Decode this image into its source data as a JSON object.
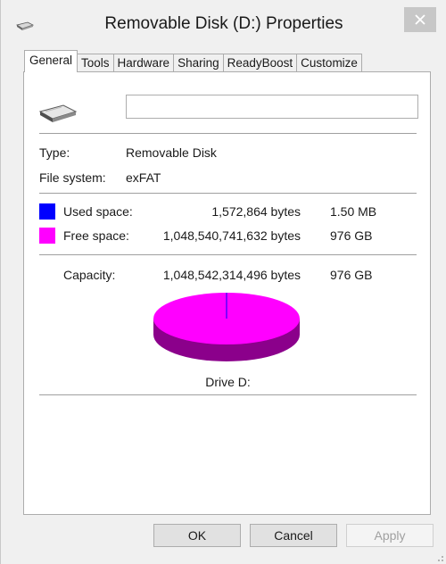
{
  "window": {
    "title": "Removable Disk (D:) Properties"
  },
  "tabs": [
    "General",
    "Tools",
    "Hardware",
    "Sharing",
    "ReadyBoost",
    "Customize"
  ],
  "general": {
    "name_value": "",
    "type_label": "Type:",
    "type_value": "Removable Disk",
    "fs_label": "File system:",
    "fs_value": "exFAT",
    "used": {
      "label": "Used space:",
      "bytes": "1,572,864 bytes",
      "size": "1.50 MB",
      "color": "#0000ff"
    },
    "free": {
      "label": "Free space:",
      "bytes": "1,048,540,741,632 bytes",
      "size": "976 GB",
      "color": "#ff00ff"
    },
    "capacity": {
      "label": "Capacity:",
      "bytes": "1,048,542,314,496 bytes",
      "size": "976 GB"
    },
    "drive_label": "Drive D:",
    "pie": {
      "used_fraction": 1.5e-06,
      "free_color": "#ff00ff",
      "free_shadow_color": "#8b008b",
      "used_color": "#0000ff"
    }
  },
  "buttons": {
    "ok": "OK",
    "cancel": "Cancel",
    "apply": "Apply"
  },
  "icons": {
    "title": "drive-icon",
    "close": "close-icon"
  }
}
